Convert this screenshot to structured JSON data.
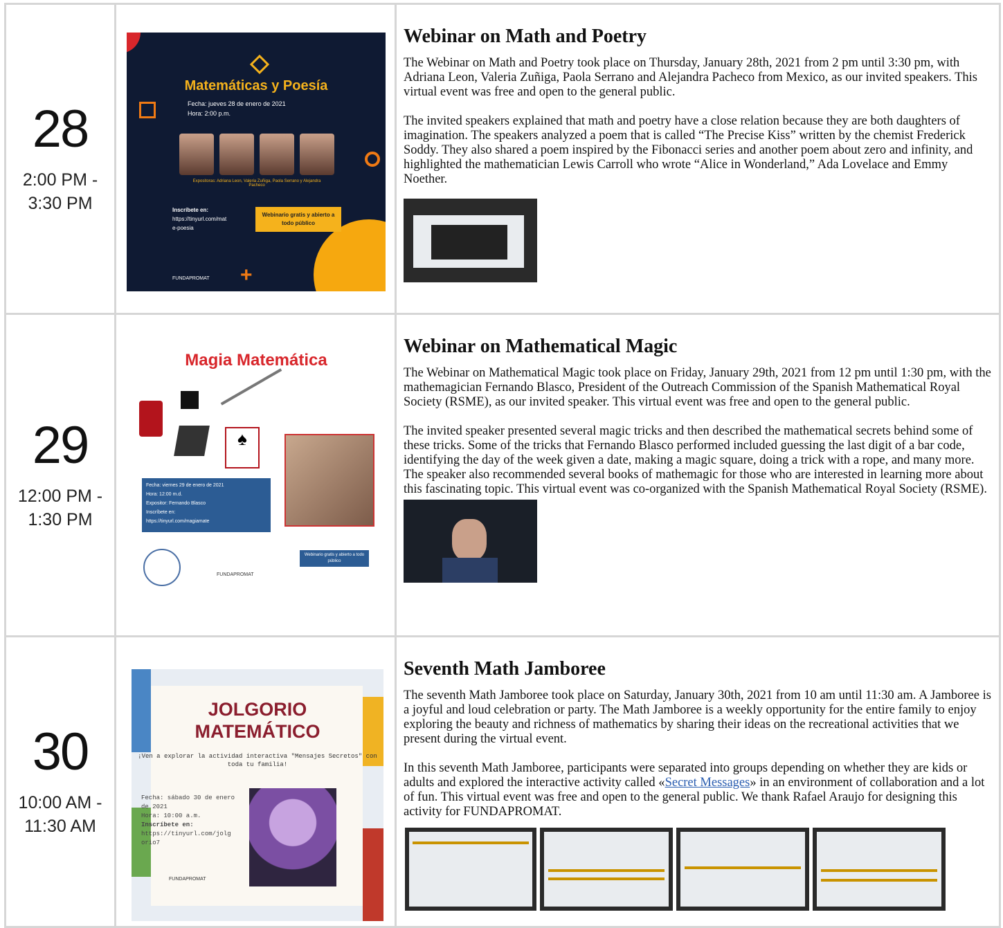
{
  "rows": [
    {
      "day": "28",
      "time_start": "2:00 PM -",
      "time_end": "3:30 PM",
      "title": "Webinar on Math and Poetry",
      "paragraphs": [
        "The Webinar on Math and Poetry took place on Thursday, January 28th, 2021 from 2 pm until 3:30 pm, with Adriana Leon, Valeria Zuñiga, Paola Serrano and Alejandra Pacheco from Mexico, as our invited speakers. This virtual event was free and open to the general public.",
        "The invited speakers explained that math and poetry have a close relation because they are both daughters of imagination. The speakers analyzed a poem that is called “The Precise Kiss” written by the chemist Frederick Soddy. They also shared a poem inspired by the Fibonacci series and another poem about zero and infinity, and highlighted the mathematician Lewis Carroll who wrote “Alice in Wonderland,” Ada Lovelace and Emmy Noether."
      ],
      "flyer": {
        "title": "Matemáticas y Poesía",
        "fecha": "Fecha: jueves 28 de enero de 2021",
        "hora": "Hora: 2:00 p.m.",
        "speakers": "Expositoras: Adriana Leon, Valeria Zuñiga, Paola Serrano y Alejandra Pacheco",
        "inscribete": "Inscríbete en:",
        "url": "https://tinyurl.com/mate-poesia",
        "badge": "Webinario gratis y abierto a todo público",
        "org": "FUNDAPROMAT"
      }
    },
    {
      "day": "29",
      "time_start": "12:00 PM -",
      "time_end": "1:30 PM",
      "title": "Webinar on Mathematical Magic",
      "paragraphs": [
        "The Webinar on Mathematical Magic took place on Friday, January 29th, 2021 from 12 pm until 1:30 pm, with the mathemagician Fernando Blasco, President of the Outreach Commission of the Spanish Mathematical Royal Society (RSME), as our invited speaker. This virtual event was free and open to the general public.",
        "The invited speaker presented several magic tricks and then described the mathematical secrets behind some of these tricks. Some of the tricks that Fernando Blasco performed included guessing the last digit of a bar code, identifying the day of the week given a date, making a magic square, doing a trick with a rope, and many more. The speaker also recommended several books of mathemagic for those who are interested in learning more about this fascinating topic. This virtual event was co-organized with the Spanish Mathematical Royal Society (RSME)."
      ],
      "flyer": {
        "title": "Magia Matemática",
        "fecha": "Fecha: viernes 29 de enero de 2021",
        "hora": "Hora: 12:00 m.d.",
        "expositor": "Expositor: Fernando Blasco",
        "inscribete": "Inscríbete en:",
        "url": "https://tinyurl.com/magiamate",
        "badge": "Webinario gratis y abierto a todo público",
        "org": "FUNDAPROMAT"
      }
    },
    {
      "day": "30",
      "time_start": "10:00 AM -",
      "time_end": "11:30 AM",
      "title": "Seventh Math Jamboree",
      "paragraph1": "The seventh Math Jamboree took place on Saturday, January 30th, 2021 from 10 am until 11:30 am. A Jamboree is a joyful and loud celebration or party. The Math Jamboree is a weekly opportunity for the entire family to enjoy exploring the beauty and richness of mathematics by sharing their ideas on the recreational activities that we present during the virtual event.",
      "paragraph2_before": "In this seventh Math Jamboree, participants were separated into groups depending on whether they are kids or adults and explored the interactive activity called «",
      "paragraph2_link": "Secret Messages",
      "paragraph2_after": "» in an environment of collaboration and a lot of fun. This virtual event was free and open to the general public. We thank Rafael Araujo for designing this activity for FUNDAPROMAT.",
      "flyer": {
        "title_line1": "JOLGORIO",
        "title_line2": "MATEMÁTICO",
        "sub": "¡Ven a explorar la actividad interactiva \"Mensajes Secretos\" con toda tu familia!",
        "fecha": "Fecha: sábado 30 de enero de 2021",
        "hora": "Hora: 10:00 a.m.",
        "inscribete": "Inscríbete en:",
        "url": "https://tinyurl.com/jolgorio7",
        "org": "FUNDAPROMAT"
      }
    }
  ],
  "colors": {
    "border": "#d6d6d6",
    "link": "#2a5db0",
    "flyer1_bg": "#0f1a33",
    "flyer1_accent": "#f5b21c",
    "flyer2_title": "#d8262b",
    "flyer3_title": "#8b1e2e"
  }
}
